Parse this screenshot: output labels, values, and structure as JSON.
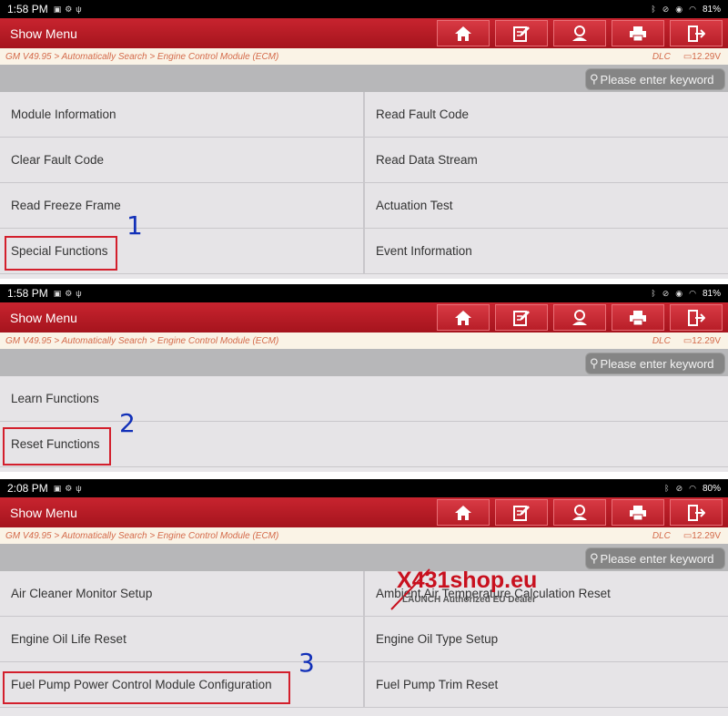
{
  "panels": [
    {
      "status": {
        "time": "1:58 PM",
        "battery": "81%"
      },
      "title": "Show Menu",
      "breadcrumb": "GM V49.95 > Automatically Search > Engine Control Module (ECM)",
      "dlc": "DLC",
      "voltage": "12.29V",
      "search_placeholder": "Please enter keyword",
      "items": [
        "Module Information",
        "Read Fault Code",
        "Clear Fault Code",
        "Read Data Stream",
        "Read Freeze Frame",
        "Actuation Test",
        "Special Functions",
        "Event Information"
      ],
      "annotation": "1"
    },
    {
      "status": {
        "time": "1:58 PM",
        "battery": "81%"
      },
      "title": "Show Menu",
      "breadcrumb": "GM V49.95 > Automatically Search > Engine Control Module (ECM)",
      "dlc": "DLC",
      "voltage": "12.29V",
      "search_placeholder": "Please enter keyword",
      "items": [
        "Learn Functions",
        "Reset Functions"
      ],
      "annotation": "2"
    },
    {
      "status": {
        "time": "2:08 PM",
        "battery": "80%"
      },
      "title": "Show Menu",
      "breadcrumb": "GM V49.95 > Automatically Search > Engine Control Module (ECM)",
      "dlc": "DLC",
      "voltage": "12.29V",
      "search_placeholder": "Please enter keyword",
      "items": [
        "Air Cleaner Monitor Setup",
        "Ambient Air Temperature Calculation Reset",
        "Engine Oil Life Reset",
        "Engine Oil Type Setup",
        "Fuel Pump Power Control Module Configuration",
        "Fuel Pump Trim Reset"
      ],
      "annotation": "3"
    }
  ],
  "toolbar_icons": [
    "home-icon",
    "edit-icon",
    "user-icon",
    "print-icon",
    "exit-icon"
  ],
  "watermark": {
    "brand_x": "X",
    "brand_431": "431",
    "brand_shop": "shop.eu",
    "tagline": "LAUNCH Authorized EU Dealer"
  },
  "colors": {
    "title_red": "#b81c26",
    "highlight_box": "#d31f2c",
    "annotation_blue": "#1230b8",
    "breadcrumb_text": "#d46a4a"
  }
}
